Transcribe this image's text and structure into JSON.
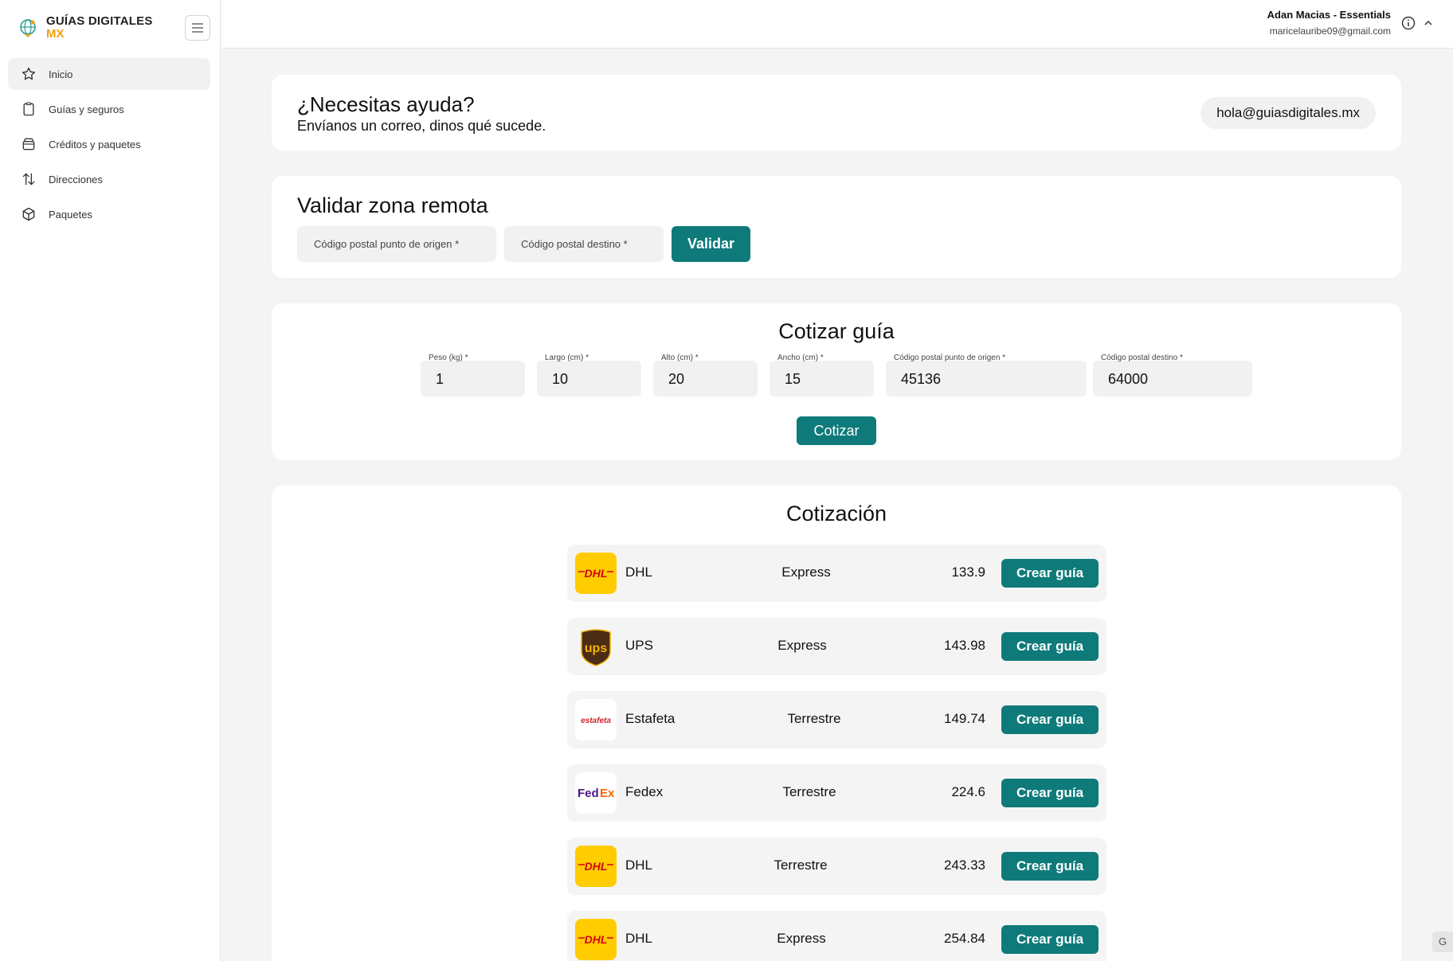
{
  "brand": {
    "line1": "GUÍAS DIGITALES",
    "line2": "MX"
  },
  "sidebar": {
    "items": [
      {
        "label": "Inicio",
        "icon": "star-icon",
        "active": true
      },
      {
        "label": "Guías y seguros",
        "icon": "clipboard-icon"
      },
      {
        "label": "Créditos y paquetes",
        "icon": "wallet-icon"
      },
      {
        "label": "Direcciones",
        "icon": "arrows-updown-icon"
      },
      {
        "label": "Paquetes",
        "icon": "box-icon"
      }
    ]
  },
  "header": {
    "user_name": "Adan Macias - Essentials",
    "user_email": "maricelauribe09@gmail.com"
  },
  "help": {
    "title": "¿Necesitas ayuda?",
    "subtitle": "Envíanos un correo, dinos qué sucede.",
    "email": "hola@guiasdigitales.mx"
  },
  "remote": {
    "title": "Validar zona remota",
    "origin_placeholder": "Código postal punto de origen *",
    "dest_placeholder": "Código postal destino *",
    "button": "Validar"
  },
  "quote": {
    "title": "Cotizar guía",
    "fields": [
      {
        "label": "Peso (kg) *",
        "value": "1"
      },
      {
        "label": "Largo (cm) *",
        "value": "10"
      },
      {
        "label": "Alto (cm) *",
        "value": "20"
      },
      {
        "label": "Ancho (cm) *",
        "value": "15"
      },
      {
        "label": "Código postal punto de origen *",
        "value": "45136"
      },
      {
        "label": "Código postal destino *",
        "value": "64000"
      }
    ],
    "button": "Cotizar"
  },
  "results": {
    "title": "Cotización",
    "button_label": "Crear guía",
    "rows": [
      {
        "carrier": "DHL",
        "service": "Express",
        "price": "133.9",
        "logo": "dhl-logo"
      },
      {
        "carrier": "UPS",
        "service": "Express",
        "price": "143.98",
        "logo": "ups-logo"
      },
      {
        "carrier": "Estafeta",
        "service": "Terrestre",
        "price": "149.74",
        "logo": "estafeta-logo"
      },
      {
        "carrier": "Fedex",
        "service": "Terrestre",
        "price": "224.6",
        "logo": "fedex-logo"
      },
      {
        "carrier": "DHL",
        "service": "Terrestre",
        "price": "243.33",
        "logo": "dhl-logo"
      },
      {
        "carrier": "DHL",
        "service": "Express",
        "price": "254.84",
        "logo": "dhl-logo"
      }
    ]
  },
  "corner_tab": "G",
  "colors": {
    "primary": "#0f7a7a",
    "brand_accent": "#f59e0b",
    "background": "#f4f4f5"
  }
}
